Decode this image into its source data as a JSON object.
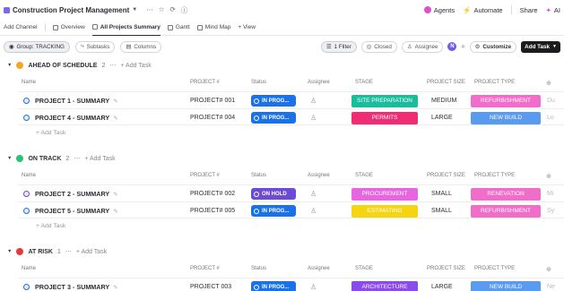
{
  "topbar": {
    "title": "Construction Project Management",
    "agents": "Agents",
    "automate": "Automate",
    "share": "Share",
    "ai": "AI"
  },
  "views": {
    "add_channel": "Add Channel",
    "overview": "Overview",
    "all_projects_summary": "All Projects Summary",
    "gantt": "Gantt",
    "mind_map": "Mind Map",
    "add_view": "+ View"
  },
  "toolbar": {
    "group": "Group: TRACKING",
    "subtasks": "Subtasks",
    "columns": "Columns",
    "filter": "1 Filter",
    "closed": "Closed",
    "assignee": "Assignee",
    "avatar": "N",
    "customize": "Customize",
    "add_task": "Add Task"
  },
  "columns": {
    "name": "Name",
    "project_no": "PROJECT #",
    "status": "Status",
    "assignee": "Assignee",
    "stage": "STAGE",
    "project_size": "PROJECT SIZE",
    "project_type": "PROJECT TYPE"
  },
  "add_task_label": "+ Add Task",
  "add_task_row_label": "Add Task",
  "groups": [
    {
      "name": "AHEAD OF SCHEDULE",
      "count": "2",
      "icon_color": "#f5a623",
      "tasks": [
        {
          "name": "PROJECT 1 - SUMMARY",
          "project_no": "PROJECT# 001",
          "status": "IN PROG...",
          "status_color": "#1b72e8",
          "stage": "SITE PREPARATION",
          "stage_color": "#1bbc9c",
          "size": "MEDIUM",
          "type": "REFURBISHMENT",
          "type_color": "#f06ec9",
          "extra": "Du"
        },
        {
          "name": "PROJECT 4 - SUMMARY",
          "project_no": "PROJECT# 004",
          "status": "IN PROG...",
          "status_color": "#1b72e8",
          "stage": "PERMITS",
          "stage_color": "#ee2d74",
          "size": "LARGE",
          "type": "NEW BUILD",
          "type_color": "#5a9bf0",
          "extra": "Lo"
        }
      ]
    },
    {
      "name": "ON TRACK",
      "count": "2",
      "icon_color": "#2ebf78",
      "tasks": [
        {
          "name": "PROJECT 2 - SUMMARY",
          "project_no": "PROJECT# 002",
          "status": "ON HOLD",
          "status_color": "#6e4bd6",
          "stage": "PROCUREMENT",
          "stage_color": "#e665e0",
          "size": "SMALL",
          "type": "RENEVATION",
          "type_color": "#f06ec9",
          "extra": "Mi"
        },
        {
          "name": "PROJECT 5 - SUMMARY",
          "project_no": "PROJECT# 005",
          "status": "IN PROG...",
          "status_color": "#1b72e8",
          "stage": "ESTIMATING",
          "stage_color": "#f7d410",
          "size": "SMALL",
          "type": "REFURBISHMENT",
          "type_color": "#f06ec9",
          "extra": "Sy"
        }
      ]
    },
    {
      "name": "AT RISK",
      "count": "1",
      "icon_color": "#e5393b",
      "tasks": [
        {
          "name": "PROJECT 3 - SUMMARY",
          "project_no": "PROJECT 003",
          "status": "IN PROG...",
          "status_color": "#1b72e8",
          "stage": "ARCHITECTURE",
          "stage_color": "#8a4bea",
          "size": "LARGE",
          "type": "NEW BUILD",
          "type_color": "#5a9bf0",
          "extra": "Ne"
        }
      ]
    }
  ]
}
